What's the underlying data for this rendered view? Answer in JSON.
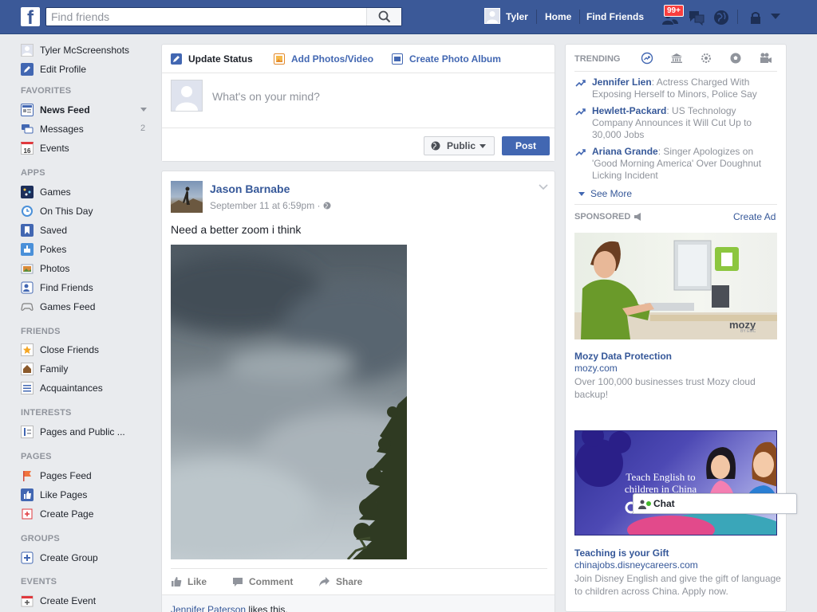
{
  "topbar": {
    "logo": "f",
    "search_placeholder": "Find friends",
    "user_name": "Tyler",
    "home": "Home",
    "find_friends": "Find Friends",
    "notif_count": "99+"
  },
  "leftnav": {
    "profile_name": "Tyler McScreenshots",
    "edit_profile": "Edit Profile",
    "sections": {
      "favorites": "FAVORITES",
      "apps": "APPS",
      "friends": "FRIENDS",
      "interests": "INTERESTS",
      "pages": "PAGES",
      "groups": "GROUPS",
      "events": "EVENTS"
    },
    "favorites": [
      "News Feed",
      "Messages",
      "Events"
    ],
    "messages_count": "2",
    "events_day": "16",
    "apps": [
      "Games",
      "On This Day",
      "Saved",
      "Pokes",
      "Photos",
      "Find Friends",
      "Games Feed"
    ],
    "friends": [
      "Close Friends",
      "Family",
      "Acquaintances"
    ],
    "interests": [
      "Pages and Public ..."
    ],
    "pages": [
      "Pages Feed",
      "Like Pages",
      "Create Page"
    ],
    "groups": [
      "Create Group"
    ],
    "events": [
      "Create Event"
    ]
  },
  "composer": {
    "tab_status": "Update Status",
    "tab_photos": "Add Photos/Video",
    "tab_album": "Create Photo Album",
    "placeholder": "What's on your mind?",
    "privacy": "Public",
    "post": "Post"
  },
  "post": {
    "author": "Jason Barnabe",
    "time": "September 11 at 6:59pm ·",
    "text": "Need a better zoom i think",
    "like": "Like",
    "comment": "Comment",
    "share": "Share",
    "likes_by": "Jennifer Paterson",
    "likes_suffix": " likes this."
  },
  "trending": {
    "title": "TRENDING",
    "items": [
      {
        "name": "Jennifer Lien",
        "text": ": Actress Charged With Exposing Herself to Minors, Police Say"
      },
      {
        "name": "Hewlett-Packard",
        "text": ": US Technology Company Announces it Will Cut Up to 30,000 Jobs"
      },
      {
        "name": "Ariana Grande",
        "text": ": Singer Apologizes on 'Good Morning America' Over Doughnut Licking Incident"
      }
    ],
    "see_more": "See More"
  },
  "sponsored": {
    "title": "SPONSORED",
    "create_ad": "Create Ad",
    "ads": [
      {
        "logo": "mozy",
        "logo_sub": "BY EMC",
        "title": "Mozy Data Protection",
        "domain": "mozy.com",
        "desc": "Over 100,000 businesses trust Mozy cloud backup!"
      },
      {
        "banner": "Teach English to children in China",
        "title": "Teaching is your Gift",
        "domain": "chinajobs.disneycareers.com",
        "desc": "Join Disney English and give the gift of language to children across China. Apply now."
      }
    ]
  },
  "chat": {
    "label": "Chat"
  }
}
